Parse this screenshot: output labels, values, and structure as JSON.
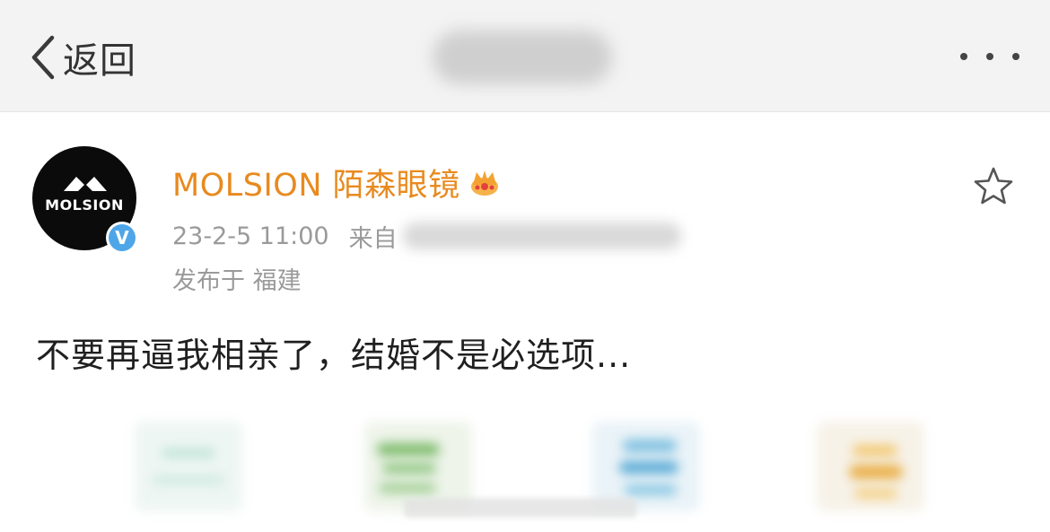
{
  "nav": {
    "back_label": "返回",
    "title_blurred": true,
    "icons": {
      "back": "chevron-left-icon",
      "more": "more-dots-icon"
    }
  },
  "post": {
    "avatar_text": "MOLSION",
    "verified_mark": "V",
    "username": "MOLSION 陌森眼镜",
    "timestamp": "23-2-5 11:00",
    "source_prefix": "来自",
    "location": "发布于 福建",
    "text": "不要再逼我相亲了，结婚不是必选项...",
    "images_count_visible": 4,
    "colors": {
      "username": "#e88a1f",
      "meta": "#9a9a9a",
      "verified": "#4ea6e8"
    }
  }
}
